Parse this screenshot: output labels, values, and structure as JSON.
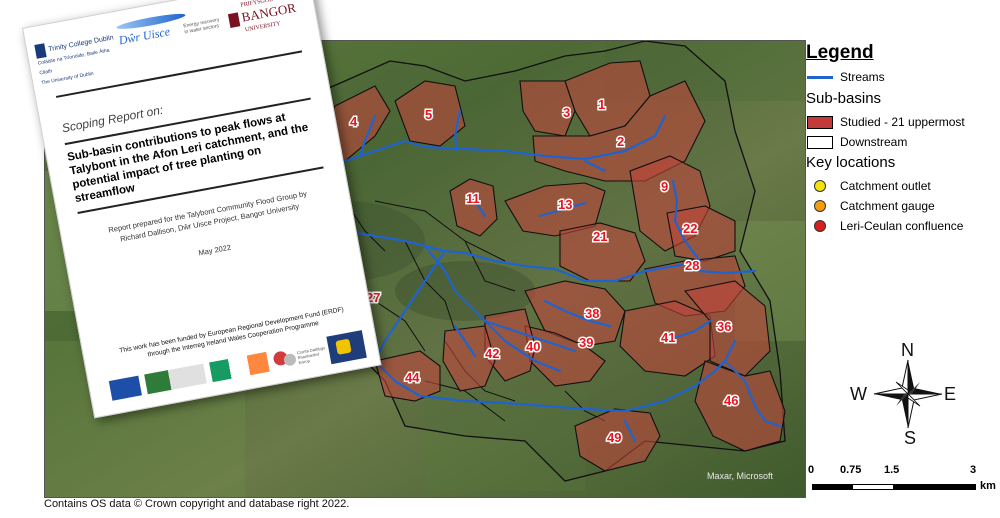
{
  "report": {
    "logos": {
      "tcd": "Trinity College Dublin",
      "tcd_sub": "Coláiste na Tríonóide, Baile Átha Cliath",
      "tcd_sub2": "The University of Dublin",
      "dwr_uisce": "Dŵr Uisce",
      "project_text": "Energy recovery in water sectors",
      "bangor": "BANGOR",
      "bangor_top": "PRIFYSGOL",
      "bangor_bottom": "UNIVERSITY"
    },
    "scoping_label": "Scoping Report on:",
    "title": "Sub-basin contributions to peak flows at Talybont in the Afon Leri catchment, and the potential impact of tree planting on streamflow",
    "prepared_by": "Report prepared for the Talybont Community Flood Group by Richard Dallison, Dŵr Uisce Project, Bangor University",
    "date": "May 2022",
    "funding": "This work has been funded by European Regional Development Fund (ERDF) through the Interreg Ireland Wales Cooperation Programme",
    "funder_welsh": "Cronfa Datblygu Rhanbarthol Ewrop"
  },
  "basins": {
    "labels": [
      "1",
      "2",
      "3",
      "4",
      "5",
      "9",
      "11",
      "13",
      "21",
      "22",
      "27",
      "28",
      "36",
      "38",
      "39",
      "40",
      "41",
      "42",
      "44",
      "46",
      "49"
    ]
  },
  "map_credit": "Maxar, Microsoft",
  "attribution": "Contains OS data © Crown copyright and database right 2022.",
  "legend": {
    "title": "Legend",
    "streams": "Streams",
    "subbasins_heading": "Sub-basins",
    "studied": "Studied - 21 uppermost",
    "downstream": "Downstream",
    "key_locations_heading": "Key locations",
    "catchment_outlet": "Catchment outlet",
    "catchment_gauge": "Catchment gauge",
    "confluence": "Leri-Ceulan confluence",
    "compass": {
      "n": "N",
      "e": "E",
      "s": "S",
      "w": "W"
    },
    "scale": {
      "ticks": [
        "0",
        "0.75",
        "1.5",
        "3"
      ],
      "unit": "km"
    },
    "colors": {
      "stream": "#1f63d0",
      "studied_fill": "#c23b3b",
      "outlet": "#f4e20a",
      "gauge": "#f39c12",
      "confluence": "#d81e1e"
    }
  }
}
